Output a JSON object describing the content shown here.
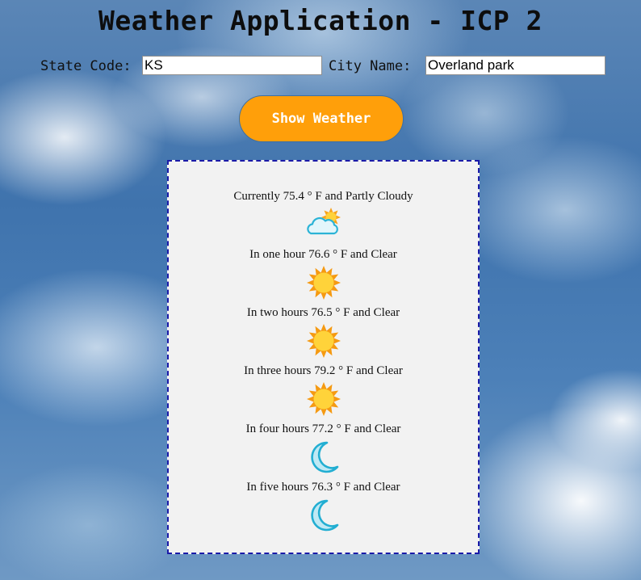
{
  "page": {
    "title": "Weather Application - ICP 2"
  },
  "form": {
    "state_label": "State Code:",
    "state_value": "KS",
    "city_label": "City Name:",
    "city_value": "Overland park",
    "submit_label": "Show Weather"
  },
  "colors": {
    "button": "#ff9f0a",
    "panel_border": "#1a1aa8",
    "panel_bg": "#f2f2f2"
  },
  "forecast": [
    {
      "text": "Currently 75.4 ° F and Partly Cloudy",
      "icon": "partly-cloudy-icon"
    },
    {
      "text": "In one hour 76.6 ° F and Clear",
      "icon": "sun-icon"
    },
    {
      "text": "In two hours 76.5 ° F and Clear",
      "icon": "sun-icon"
    },
    {
      "text": "In three hours 79.2 ° F and Clear",
      "icon": "sun-icon"
    },
    {
      "text": "In four hours 77.2 ° F and Clear",
      "icon": "moon-icon"
    },
    {
      "text": "In five hours 76.3 ° F and Clear",
      "icon": "moon-icon"
    }
  ]
}
